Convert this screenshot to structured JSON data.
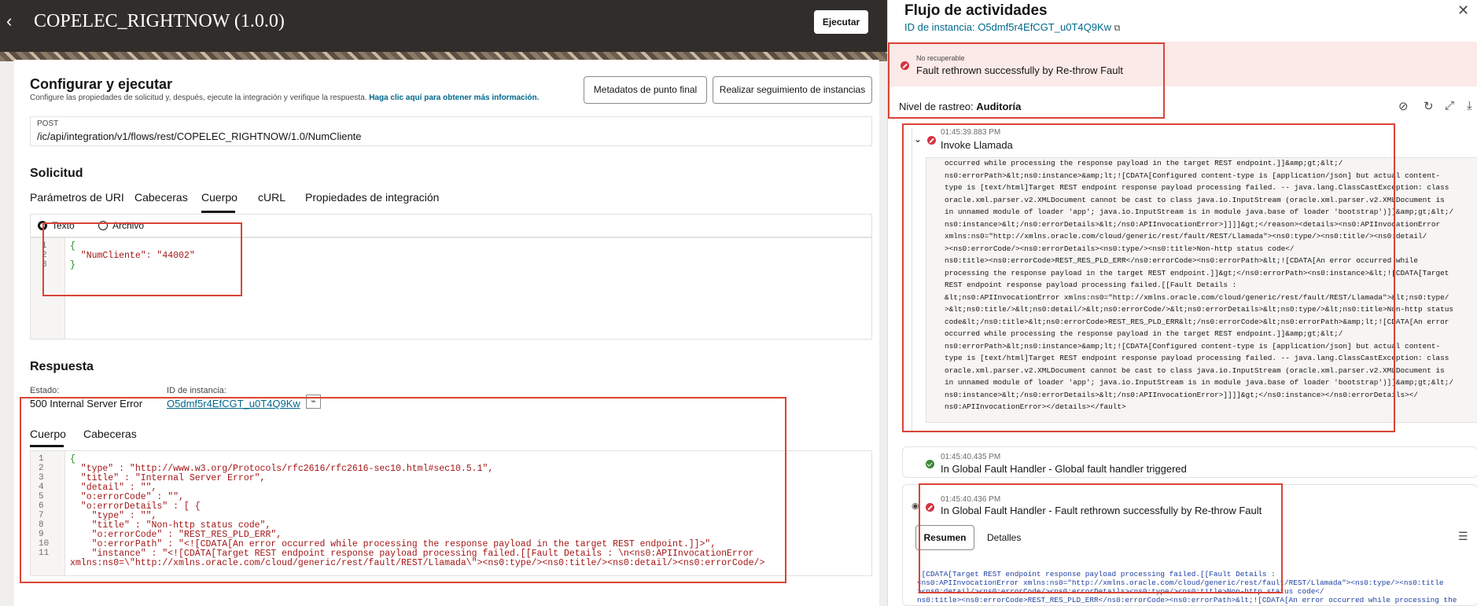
{
  "header": {
    "title": "COPELEC_RIGHTNOW (1.0.0)",
    "run_label": "Ejecutar"
  },
  "config": {
    "title": "Configurar y ejecutar",
    "desc": "Configure las propiedades de solicitud y, después, ejecute la integración y verifique la respuesta.",
    "help_link": "Haga clic aquí para obtener más información.",
    "endpoint_btn": "Metadatos de punto final",
    "track_btn": "Realizar seguimiento de instancias"
  },
  "endpoint": {
    "method": "POST",
    "url": "/ic/api/integration/v1/flows/rest/COPELEC_RIGHTNOW/1.0/NumCliente"
  },
  "request": {
    "title": "Solicitud",
    "tabs": [
      "Parámetros de URI",
      "Cabeceras",
      "Cuerpo",
      "cURL",
      "Propiedades de integración"
    ],
    "radio_text": "Texto",
    "radio_file": "Archivo",
    "body": [
      {
        "n": "1",
        "t": "{"
      },
      {
        "n": "2",
        "t": "  \"NumCliente\": \"44002\""
      },
      {
        "n": "3",
        "t": "}"
      }
    ]
  },
  "response": {
    "title": "Respuesta",
    "status_label": "Estado:",
    "status": "500 Internal Server Error",
    "instance_label": "ID de instancia:",
    "instance": "O5dmf5r4EfCGT_u0T4Q9Kw",
    "tabs": [
      "Cuerpo",
      "Cabeceras"
    ],
    "body": [
      {
        "n": "1",
        "t": "{"
      },
      {
        "n": "2",
        "t": "  \"type\" : \"http://www.w3.org/Protocols/rfc2616/rfc2616-sec10.html#sec10.5.1\","
      },
      {
        "n": "3",
        "t": "  \"title\" : \"Internal Server Error\","
      },
      {
        "n": "4",
        "t": "  \"detail\" : \"\","
      },
      {
        "n": "5",
        "t": "  \"o:errorCode\" : \"\","
      },
      {
        "n": "6",
        "t": "  \"o:errorDetails\" : [ {"
      },
      {
        "n": "7",
        "t": "    \"type\" : \"\","
      },
      {
        "n": "8",
        "t": "    \"title\" : \"Non-http status code\","
      },
      {
        "n": "9",
        "t": "    \"o:errorCode\" : \"REST_RES_PLD_ERR\","
      },
      {
        "n": "10",
        "t": "    \"o:errorPath\" : \"<![CDATA[An error occurred while processing the response payload in the target REST endpoint.]]>\","
      },
      {
        "n": "11",
        "t": "    \"instance\" : \"<![CDATA[Target REST endpoint response payload processing failed.[[Fault Details : \\n<ns0:APIInvocationError"
      },
      {
        "n": "",
        "t": "xmlns:ns0=\\\"http://xmlns.oracle.com/cloud/generic/rest/fault/REST/Llamada\\\"><ns0:type/><ns0:title/><ns0:detail/><ns0:errorCode/>"
      }
    ]
  },
  "panel": {
    "title": "Flujo de actividades",
    "instance_label": "ID de instancia: O5dmf5r4EfCGT_u0T4Q9Kw",
    "fault_kind": "No recuperable",
    "fault_msg": "Fault rethrown successfully by Re-throw Fault",
    "trace_label": "Nivel de rastreo:",
    "trace_value": "Auditoría",
    "act1": {
      "time": "01:45:39.883 PM",
      "name": "Invoke Llamada"
    },
    "act2": {
      "time": "01:45:40.435 PM",
      "name": "In Global Fault Handler - Global fault handler triggered"
    },
    "act3": {
      "time": "01:45:40.436 PM",
      "name": "In Global Fault Handler - Fault rethrown successfully by Re-throw Fault",
      "tab_summary": "Resumen",
      "tab_details": "Detalles"
    },
    "log": [
      "occurred while processing the response payload in the target REST endpoint.]]&amp;gt;&lt;/",
      "ns0:errorPath>&lt;ns0:instance>&amp;lt;![CDATA[Configured content-type is [application/json] but actual content-",
      "type is [text/html]Target REST endpoint response payload processing failed. -- java.lang.ClassCastException: class",
      "oracle.xml.parser.v2.XMLDocument cannot be cast to class java.io.InputStream (oracle.xml.parser.v2.XMLDocument is",
      "in unnamed module of loader 'app'; java.io.InputStream is in module java.base of loader 'bootstrap')]]&amp;gt;&lt;/",
      "ns0:instance>&lt;/ns0:errorDetails>&lt;/ns0:APIInvocationError>]]]]&gt;</reason><details><ns0:APIInvocationError",
      "xmlns:ns0=\"http://xmlns.oracle.com/cloud/generic/rest/fault/REST/Llamada\"><ns0:type/><ns0:title/><ns0:detail/",
      "><ns0:errorCode/><ns0:errorDetails><ns0:type/><ns0:title>Non-http status code</",
      "ns0:title><ns0:errorCode>REST_RES_PLD_ERR</ns0:errorCode><ns0:errorPath>&lt;![CDATA[An error occurred while",
      "processing the response payload in the target REST endpoint.]]&gt;</ns0:errorPath><ns0:instance>&lt;![CDATA[Target",
      "REST endpoint response payload processing failed.[[Fault Details :",
      "&lt;ns0:APIInvocationError xmlns:ns0=\"http://xmlns.oracle.com/cloud/generic/rest/fault/REST/Llamada\">&lt;ns0:type/",
      ">&lt;ns0:title/>&lt;ns0:detail/>&lt;ns0:errorCode/>&lt;ns0:errorDetails>&lt;ns0:type/>&lt;ns0:title>Non-http status",
      "code&lt;/ns0:title>&lt;ns0:errorCode>REST_RES_PLD_ERR&lt;/ns0:errorCode>&lt;ns0:errorPath>&amp;lt;![CDATA[An error",
      "occurred while processing the response payload in the target REST endpoint.]]&amp;gt;&lt;/",
      "ns0:errorPath>&lt;ns0:instance>&amp;lt;![CDATA[Configured content-type is [application/json] but actual content-",
      "type is [text/html]Target REST endpoint response payload processing failed. -- java.lang.ClassCastException: class",
      "oracle.xml.parser.v2.XMLDocument cannot be cast to class java.io.InputStream (oracle.xml.parser.v2.XMLDocument is",
      "in unnamed module of loader 'app'; java.io.InputStream is in module java.base of loader 'bootstrap')]]&amp;gt;&lt;/",
      "ns0:instance>&lt;/ns0:errorDetails>&lt;/ns0:APIInvocationError>]]]]&gt;</ns0:instance></ns0:errorDetails></",
      "ns0:APIInvocationError></details></fault>"
    ],
    "log2": [
      "![CDATA[Target REST endpoint response payload processing failed.[[Fault Details :",
      "<ns0:APIInvocationError xmlns:ns0=\"http://xmlns.oracle.com/cloud/generic/rest/fault/REST/Llamada\"><ns0:type/><ns0:title",
      "><ns0:detail/><ns0:errorCode/><ns0:errorDetails><ns0:type/><ns0:title>Non-http status code</",
      "ns0:title><ns0:errorCode>REST_RES_PLD_ERR</ns0:errorCode><ns0:errorPath>&lt;![CDATA[An error occurred while processing the"
    ]
  }
}
